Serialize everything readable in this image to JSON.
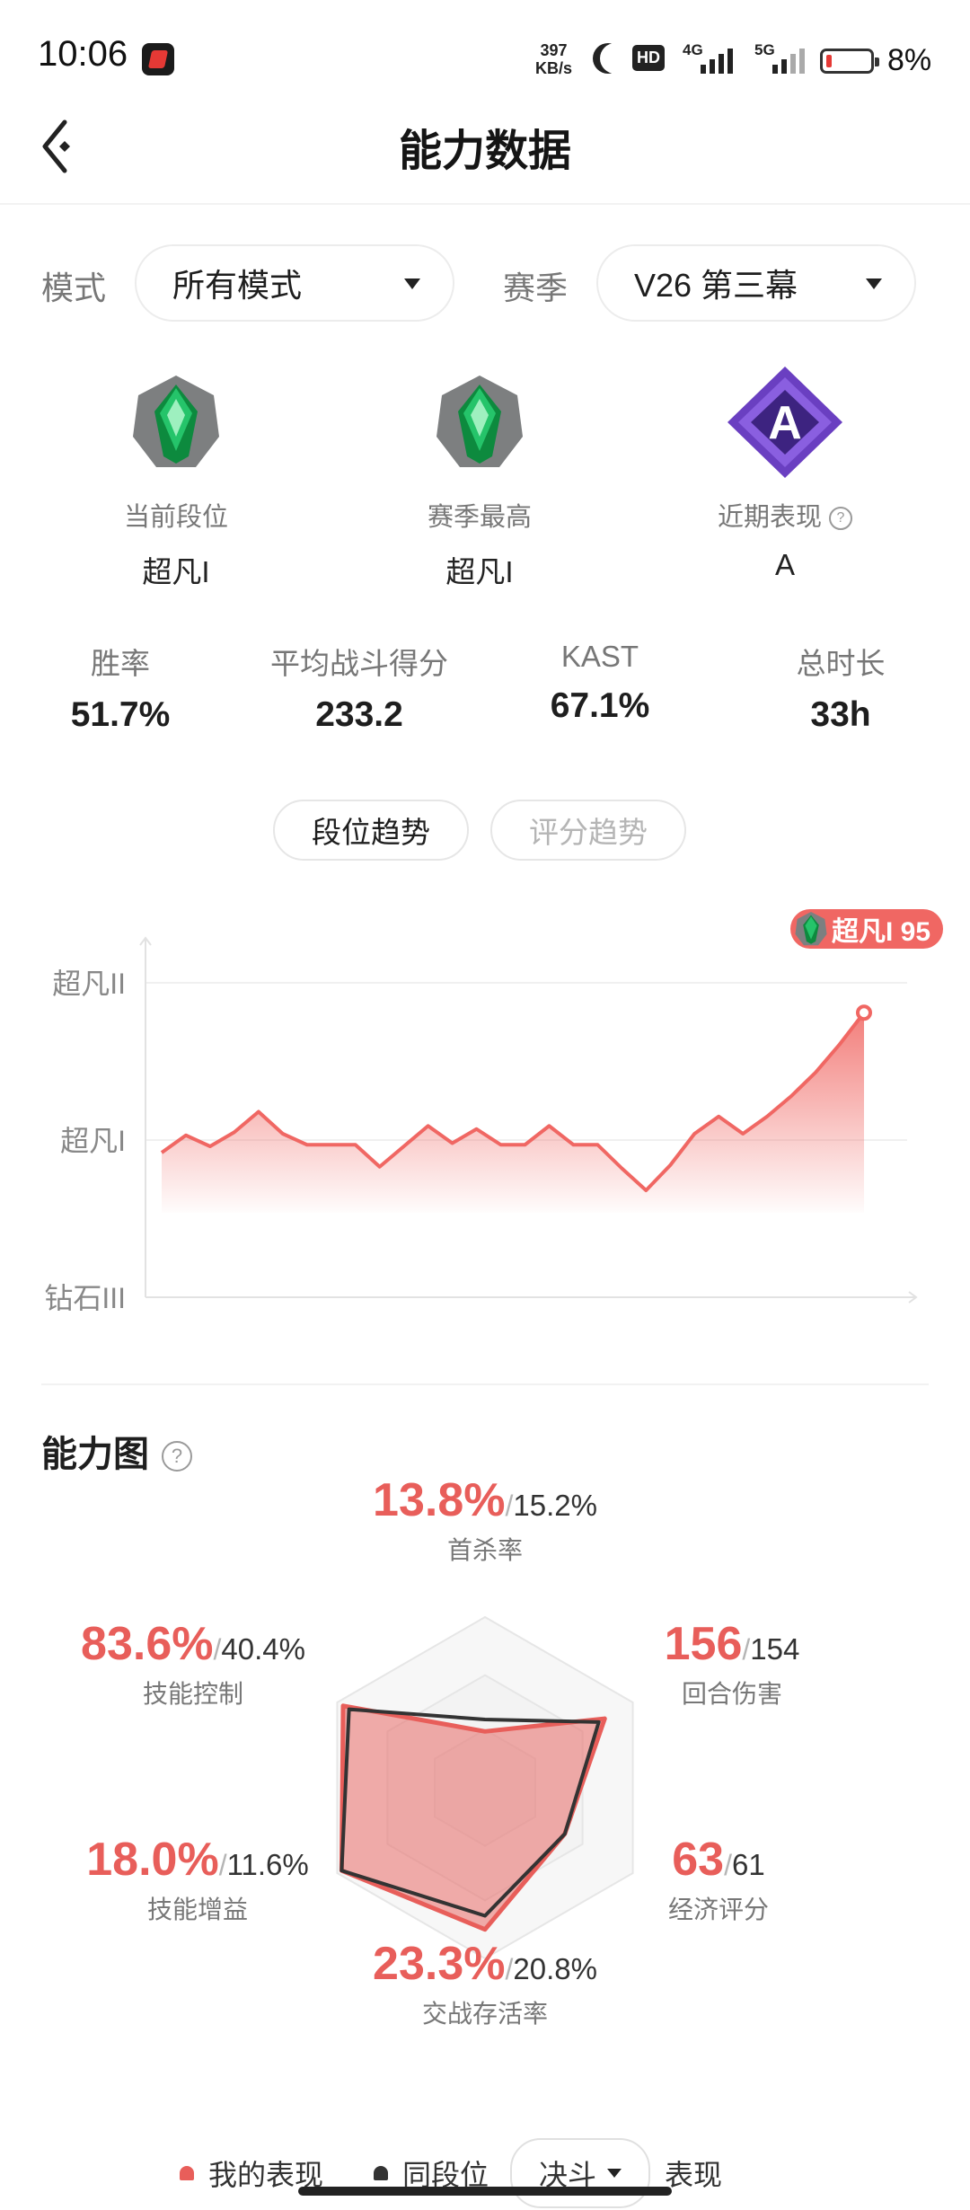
{
  "status_bar": {
    "time": "10:06",
    "net_speed_value": "397",
    "net_speed_unit": "KB/s",
    "hd": "HD",
    "sig1": "4G",
    "sig2": "5G",
    "battery": "8%"
  },
  "header": {
    "title": "能力数据"
  },
  "filters": {
    "mode_label": "模式",
    "mode_value": "所有模式",
    "season_label": "赛季",
    "season_value": "V26 第三幕"
  },
  "ranks": [
    {
      "label": "当前段位",
      "value": "超凡I"
    },
    {
      "label": "赛季最高",
      "value": "超凡I"
    },
    {
      "label": "近期表现",
      "value": "A"
    }
  ],
  "recent_badge": "A",
  "stats": [
    {
      "label": "胜率",
      "value": "51.7%"
    },
    {
      "label": "平均战斗得分",
      "value": "233.2"
    },
    {
      "label": "KAST",
      "value": "67.1%"
    },
    {
      "label": "总时长",
      "value": "33h"
    }
  ],
  "trend_tabs": {
    "active": "段位趋势",
    "inactive": "评分趋势"
  },
  "chart_data": {
    "type": "area",
    "y_categories": [
      "钻石III",
      "超凡I",
      "超凡II"
    ],
    "ylim": [
      0,
      200
    ],
    "values": [
      92,
      103,
      96,
      105,
      118,
      104,
      97,
      97,
      97,
      83,
      96,
      109,
      98,
      107,
      97,
      97,
      109,
      97,
      97,
      82,
      68,
      84,
      104,
      115,
      104,
      115,
      128,
      143,
      161,
      181
    ],
    "end_label": "超凡I 95",
    "colors": {
      "line": "#f06763",
      "fill": "#f06763"
    }
  },
  "ability": {
    "title": "能力图",
    "metrics": [
      {
        "key": "first_kill",
        "mine": "13.8%",
        "compare": "15.2%",
        "label": "首杀率"
      },
      {
        "key": "round_damage",
        "mine": "156",
        "compare": "154",
        "label": "回合伤害"
      },
      {
        "key": "economy",
        "mine": "63",
        "compare": "61",
        "label": "经济评分"
      },
      {
        "key": "survival",
        "mine": "23.3%",
        "compare": "20.8%",
        "label": "交战存活率"
      },
      {
        "key": "skill_buff",
        "mine": "18.0%",
        "compare": "11.6%",
        "label": "技能增益"
      },
      {
        "key": "skill_control",
        "mine": "83.6%",
        "compare": "40.4%",
        "label": "技能控制"
      }
    ],
    "radar_mine": [
      0.33,
      0.81,
      0.54,
      0.83,
      0.97,
      0.96
    ],
    "radar_peer": [
      0.4,
      0.77,
      0.54,
      0.75,
      0.97,
      0.92
    ],
    "legend": {
      "mine": "我的表现",
      "peer": "同段位",
      "dropdown": "决斗",
      "tail": "表现"
    },
    "colors": {
      "mine": "#e85e5a",
      "peer": "#333333"
    }
  }
}
